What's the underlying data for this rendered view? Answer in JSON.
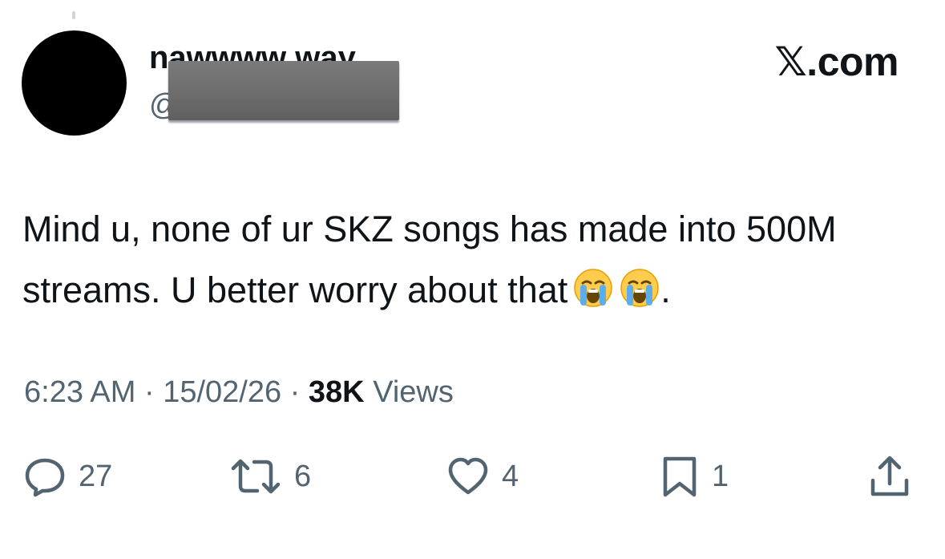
{
  "tweet": {
    "display_name": "nawwww way",
    "handle_prefix": "@",
    "site_logo": "𝕏.com",
    "text": "Mind u, none of ur SKZ songs has made into 500M streams. U better worry about that",
    "text_tail": ".",
    "emojis": [
      "loudly-crying-face",
      "loudly-crying-face"
    ],
    "time": "6:23 AM",
    "separator": " · ",
    "date": "15/02/26",
    "views_count": "38K",
    "views_label": "Views"
  },
  "actions": {
    "replies": "27",
    "reposts": "6",
    "likes": "4",
    "bookmarks": "1"
  },
  "icons": [
    "reply-icon",
    "repost-icon",
    "like-icon",
    "bookmark-icon",
    "share-icon"
  ],
  "colors": {
    "text": "#0f1419",
    "secondary": "#536471",
    "background": "#ffffff"
  }
}
